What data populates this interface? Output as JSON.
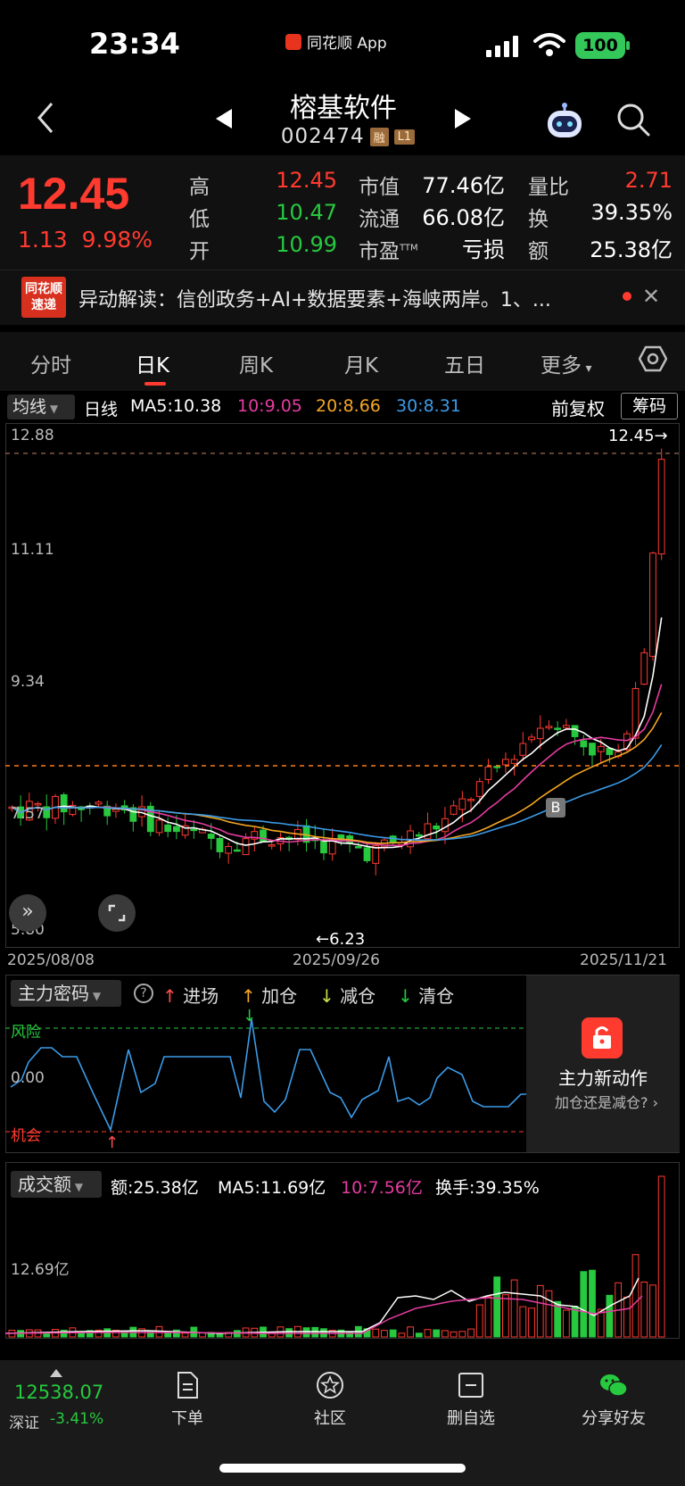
{
  "status": {
    "time": "23:34",
    "app_badge": "同花顺 App",
    "battery": "100"
  },
  "nav": {
    "stock_name": "榕基软件",
    "stock_code": "002474",
    "tag_margin": "融",
    "tag_level": "L1"
  },
  "quote": {
    "last_price": "12.45",
    "change": "1.13",
    "change_pct": "9.98%",
    "high_label": "高",
    "high": "12.45",
    "low_label": "低",
    "low": "10.47",
    "open_label": "开",
    "open": "10.99",
    "mktcap_label": "市值",
    "mktcap": "77.46亿",
    "float_label": "流通",
    "float": "66.08亿",
    "pe_label": "市盈",
    "pe_sup": "TTM",
    "pe": "亏损",
    "volratio_label": "量比",
    "volratio": "2.71",
    "turnover_label": "换",
    "turnover": "39.35%",
    "amount_label": "额",
    "amount": "25.38亿"
  },
  "news": {
    "logo_line1": "同花顺",
    "logo_line2": "速递",
    "text": "异动解读：信创政务+AI+数据要素+海峡两岸。1、..."
  },
  "tabs": [
    "分时",
    "日K",
    "周K",
    "月K",
    "五日",
    "更多"
  ],
  "ma_legend": {
    "selector": "均线",
    "period": "日线",
    "ma5": "MA5:10.38",
    "ma10": "10:9.05",
    "ma20": "20:8.66",
    "ma30": "30:8.31",
    "adjust": "前复权",
    "chip": "筹码",
    "colors": {
      "ma5": "#ffffff",
      "ma10": "#e53ca0",
      "ma20": "#f5a623",
      "ma30": "#3b9be8"
    }
  },
  "kline": {
    "y_labels": [
      "12.88",
      "11.11",
      "9.34",
      "7.57",
      "5.80"
    ],
    "high_marker": "12.45→",
    "low_marker": "←6.23",
    "dates": [
      "2025/08/08",
      "2025/09/26",
      "2025/11/21"
    ],
    "b_marker": "B"
  },
  "indicator": {
    "selector": "主力密码",
    "legend": [
      "进场",
      "加仓",
      "减仓",
      "清仓"
    ],
    "risk": "风险",
    "zero": "0.00",
    "chance": "机会",
    "promo_title": "主力新动作",
    "promo_sub": "加仓还是减仓?"
  },
  "volume": {
    "selector": "成交额",
    "amount": "额:25.38亿",
    "ma5": "MA5:11.69亿",
    "ma10": "10:7.56亿",
    "turnover": "换手:39.35%",
    "y_label": "12.69亿"
  },
  "bottom": {
    "index_value": "12538.07",
    "index_name": "深证",
    "index_change": "-3.41%",
    "order": "下单",
    "community": "社区",
    "remove_watch": "删自选",
    "share": "分享好友"
  }
}
